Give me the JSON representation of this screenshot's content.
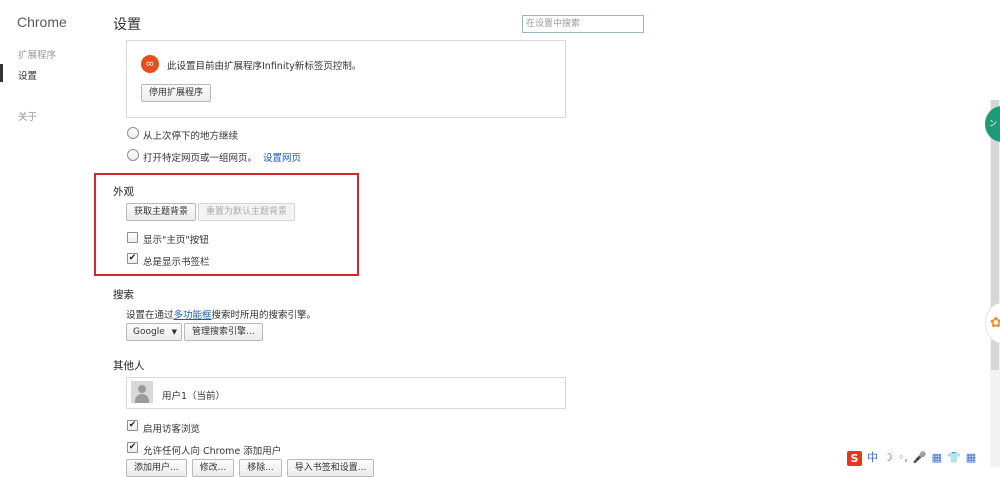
{
  "app": {
    "title": "Chrome"
  },
  "sidebar": {
    "items": [
      {
        "label": "扩展程序"
      },
      {
        "label": "设置"
      },
      {
        "label": "关于"
      }
    ]
  },
  "header": {
    "title": "设置",
    "search_placeholder": "在设置中搜索"
  },
  "startup": {
    "extension_notice": "此设置目前由扩展程序Infinity新标签页控制。",
    "extension_icon": "∞",
    "disable_extension_button": "停用扩展程序",
    "options": [
      {
        "label": "从上次停下的地方继续",
        "checked": false
      },
      {
        "label": "打开特定网页或一组网页。",
        "checked": false,
        "link": "设置网页"
      }
    ]
  },
  "appearance": {
    "title": "外观",
    "get_themes_button": "获取主题背景",
    "reset_theme_button": "重置为默认主题背景",
    "show_home_button_label": "显示\"主页\"按钮",
    "show_home_button_checked": false,
    "show_bookmarks_bar_label": "总是显示书签栏",
    "show_bookmarks_bar_checked": true,
    "highlight_color": "#d8262f"
  },
  "search": {
    "title": "搜索",
    "description_pre": "设置在通过",
    "description_link": "多功能框",
    "description_post": "搜索时所用的搜索引擎。",
    "engine_selected": "Google",
    "manage_button": "管理搜索引擎..."
  },
  "people": {
    "title": "其他人",
    "user_name": "用户1（当前）",
    "guest_browsing_label": "启用访客浏览",
    "guest_browsing_checked": true,
    "allow_add_user_label": "允许任何人向 Chrome 添加用户",
    "allow_add_user_checked": true,
    "buttons": [
      "添加用户...",
      "修改...",
      "移除...",
      "导入书签和设置..."
    ]
  },
  "ime": {
    "logo": "S",
    "items": [
      "中",
      "☽",
      "◦,",
      "🎤",
      "▦",
      "👕",
      "▦"
    ]
  },
  "floating": {
    "green_text": "ン",
    "orange_text": "✿"
  },
  "colors": {
    "link": "#1a5bb5",
    "accent_red": "#d8262f",
    "ime_red": "#e8361d"
  }
}
